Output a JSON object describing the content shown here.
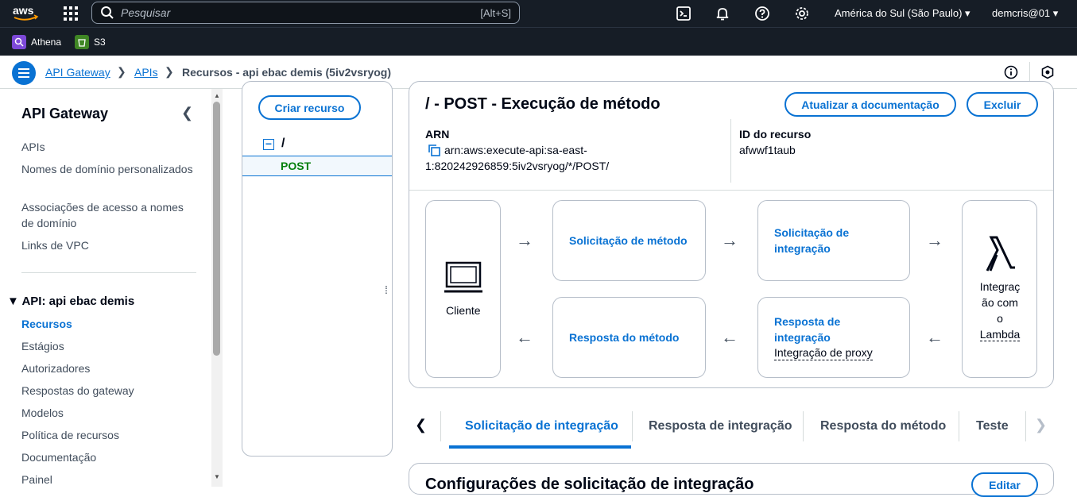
{
  "topbar": {
    "logo": "aws",
    "search_placeholder": "Pesquisar",
    "search_shortcut": "[Alt+S]",
    "region": "América do Sul (São Paulo) ▾",
    "user": "demcris@01 ▾"
  },
  "favorites": [
    {
      "label": "Athena",
      "color": "#7d49d8"
    },
    {
      "label": "S3",
      "color": "#3f8624"
    }
  ],
  "breadcrumb": {
    "items": [
      "API Gateway",
      "APIs",
      "Recursos - api ebac demis (5iv2vsryog)"
    ]
  },
  "sidebar": {
    "title": "API Gateway",
    "top_items": [
      "APIs",
      "Nomes de domínio personalizados",
      "Associações de acesso a nomes de domínio",
      "Links de VPC"
    ],
    "section_title": "API: api ebac demis",
    "section_items": [
      "Recursos",
      "Estágios",
      "Autorizadores",
      "Respostas do gateway",
      "Modelos",
      "Política de recursos",
      "Documentação",
      "Painel"
    ]
  },
  "resources": {
    "create_button": "Criar recurso",
    "root": "/",
    "method": "POST"
  },
  "method": {
    "title": "/ - POST - Execução de método",
    "update_doc_button": "Atualizar a documentação",
    "delete_button": "Excluir",
    "arn_label": "ARN",
    "arn_line1": "arn:aws:execute-api:sa-east-",
    "arn_line2": "1:820242926859:5iv2vsryog/*/POST/",
    "resource_id_label": "ID do recurso",
    "resource_id": "afwwf1taub"
  },
  "flow": {
    "client": "Cliente",
    "method_request": "Solicitação de método",
    "integration_request_1": "Solicitação de",
    "integration_request_2": "integração",
    "method_response": "Resposta do método",
    "integration_response_1": "Resposta de",
    "integration_response_2": "integração",
    "integration_response_sub": "Integração de proxy",
    "lambda_1": "Integraç",
    "lambda_2": "ão com",
    "lambda_3": "o",
    "lambda_4": "Lambda",
    "arrow_right": "→",
    "arrow_left": "←"
  },
  "tabs": {
    "items": [
      "Solicitação de integração",
      "Resposta de integração",
      "Resposta do método",
      "Teste"
    ],
    "active_index": 0
  },
  "config": {
    "title": "Configurações de solicitação de integração",
    "edit_button": "Editar"
  },
  "colors": {
    "accent": "#0972d3",
    "topbar": "#161d26",
    "post_green": "#037f0c"
  }
}
